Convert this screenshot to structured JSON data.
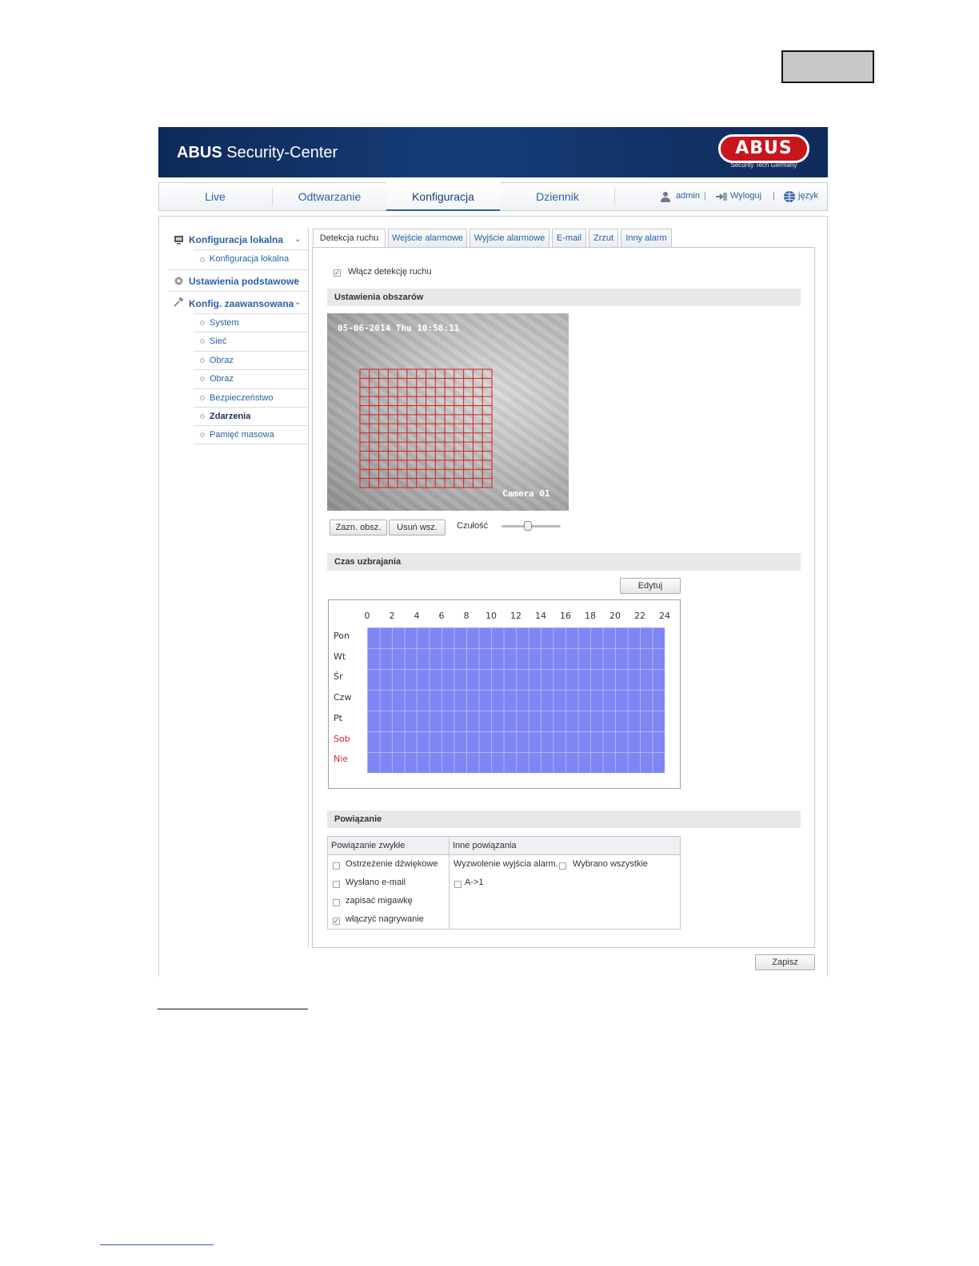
{
  "header": {
    "app_title_bold": "ABUS",
    "app_title_rest": " Security-Center",
    "logo_text": "ABUS",
    "logo_tagline": "Security Tech Germany"
  },
  "topnav": {
    "tabs": [
      {
        "label": "Live"
      },
      {
        "label": "Odtwarzanie"
      },
      {
        "label": "Konfiguracja",
        "active": true
      },
      {
        "label": "Dziennik"
      }
    ],
    "user": "admin",
    "sep": "|",
    "logout": "Wyloguj",
    "language": "język"
  },
  "sidebar": {
    "local_config": {
      "label": "Konfiguracja lokalna",
      "items": [
        {
          "label": "Konfiguracja lokalna"
        }
      ]
    },
    "basic": {
      "label": "Ustawienia podstawowe"
    },
    "advanced": {
      "label": "Konfig. zaawansowana",
      "items": [
        {
          "label": "System"
        },
        {
          "label": "Sieć"
        },
        {
          "label": "Obraz"
        },
        {
          "label": "Obraz"
        },
        {
          "label": "Bezpieczeństwo"
        },
        {
          "label": "Zdarzenia",
          "active": true
        },
        {
          "label": "Pamięć masowa"
        }
      ]
    }
  },
  "content_tabs": [
    {
      "label": "Detekcja ruchu",
      "active": true
    },
    {
      "label": "Wejście alarmowe"
    },
    {
      "label": "Wyjście alarmowe"
    },
    {
      "label": "E-mail"
    },
    {
      "label": "Zrzut"
    },
    {
      "label": "Inny alarm"
    }
  ],
  "motion": {
    "enable_label": "Włącz detekcję ruchu",
    "enable_checked": true,
    "area_section": "Ustawienia obszarów",
    "camera_timestamp": "05-06-2014 Thu 10:58:11",
    "camera_name": "Camera 01",
    "draw_area_button": "Zazn. obsz.",
    "clear_all_button": "Usuń wsz.",
    "sensitivity_label": "Czułość",
    "sensitivity_fraction": 0.45
  },
  "schedule": {
    "section": "Czas uzbrajania",
    "edit_button": "Edytuj",
    "hours": [
      "0",
      "2",
      "4",
      "6",
      "8",
      "10",
      "12",
      "14",
      "16",
      "18",
      "20",
      "22",
      "24"
    ],
    "days": [
      {
        "label": "Pon"
      },
      {
        "label": "Wt"
      },
      {
        "label": "Śr"
      },
      {
        "label": "Czw"
      },
      {
        "label": "Pt"
      },
      {
        "label": "Sob",
        "weekend": true
      },
      {
        "label": "Nie",
        "weekend": true
      }
    ],
    "fill_color": "#7f86f3"
  },
  "linkage": {
    "section": "Powiązanie",
    "col_normal": "Powiązanie zwykłe",
    "col_other": "Inne powiązania",
    "normal": [
      {
        "label": "Ostrzeżenie dźwiękowe",
        "checked": false
      },
      {
        "label": "Wysłano e-mail",
        "checked": false
      },
      {
        "label": "zapisać migawkę",
        "checked": false
      },
      {
        "label": "włączyć nagrywanie",
        "checked": true
      }
    ],
    "other_trigger": "Wyzwolenie wyjścia alarm.",
    "select_all": "Wybrano wszystkie",
    "outputs": [
      {
        "label": "A->1",
        "checked": false
      }
    ]
  },
  "save_button": "Zapisz",
  "colors": {
    "banner": "#163c78",
    "accent": "#2b5fa8",
    "logo": "#c8161d",
    "weekend": "#cc2a2a"
  }
}
